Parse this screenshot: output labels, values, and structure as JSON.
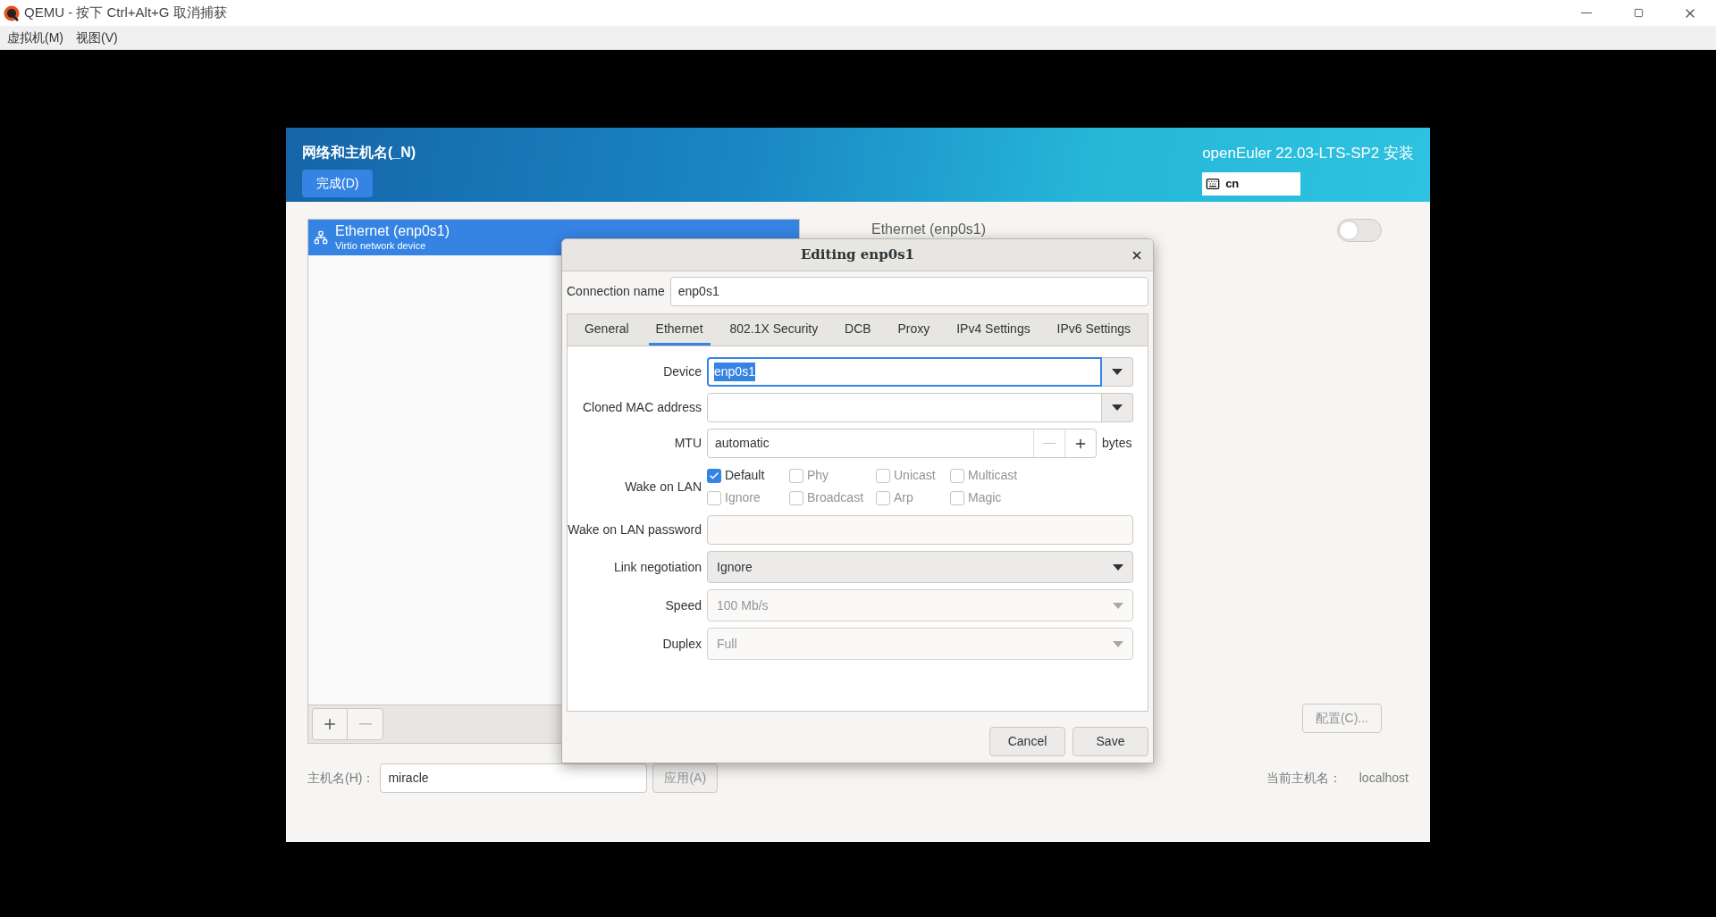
{
  "window": {
    "title": "QEMU - 按下 Ctrl+Alt+G 取消捕获"
  },
  "menu": [
    {
      "label": "虚拟机(M)"
    },
    {
      "label": "视图(V)"
    }
  ],
  "installer": {
    "title": "网络和主机名(_N)",
    "done_button": "完成(D)",
    "product": "openEuler 22.03-LTS-SP2 安装",
    "keyboard_layout": "cn"
  },
  "devices": [
    {
      "name": "Ethernet (enp0s1)",
      "description": "Virtio network device",
      "selected": true
    }
  ],
  "device_detail": {
    "title": "Ethernet (enp0s1)",
    "on": false,
    "configure_button": "配置(C)..."
  },
  "hostname": {
    "label": "主机名(H)：",
    "value": "miracle",
    "apply_button": "应用(A)",
    "current_label": "当前主机名：",
    "current_value": "localhost"
  },
  "dialog": {
    "title": "Editing enp0s1",
    "connection_name_label": "Connection name",
    "connection_name": "enp0s1",
    "tabs": [
      {
        "label": "General",
        "selected": false
      },
      {
        "label": "Ethernet",
        "selected": true
      },
      {
        "label": "802.1X Security",
        "selected": false
      },
      {
        "label": "DCB",
        "selected": false
      },
      {
        "label": "Proxy",
        "selected": false
      },
      {
        "label": "IPv4 Settings",
        "selected": false
      },
      {
        "label": "IPv6 Settings",
        "selected": false
      }
    ],
    "fields": [
      {
        "kind": "combo",
        "label": "Device",
        "value": "enp0s1",
        "focused": true
      },
      {
        "kind": "combo",
        "label": "Cloned MAC address",
        "focused": false
      },
      {
        "kind": "spin",
        "label": "MTU",
        "value": "automatic",
        "unit": "bytes"
      },
      {
        "kind": "checks",
        "label": "Wake on LAN",
        "options": [
          {
            "label": "Default",
            "checked": true,
            "disabled": false
          },
          {
            "label": "Phy",
            "checked": false,
            "disabled": true
          },
          {
            "label": "Unicast",
            "checked": false,
            "disabled": true
          },
          {
            "label": "Multicast",
            "checked": false,
            "disabled": true
          },
          {
            "label": "Ignore",
            "checked": false,
            "disabled": true
          },
          {
            "label": "Broadcast",
            "checked": false,
            "disabled": true
          },
          {
            "label": "Arp",
            "checked": false,
            "disabled": true
          },
          {
            "label": "Magic",
            "checked": false,
            "disabled": true
          }
        ]
      },
      {
        "kind": "entry",
        "label": "Wake on LAN password"
      },
      {
        "kind": "dropdown",
        "label": "Link negotiation",
        "value": "Ignore",
        "disabled": false
      },
      {
        "kind": "dropdown",
        "label": "Speed",
        "value": "100 Mb/s",
        "disabled": true
      },
      {
        "kind": "dropdown",
        "label": "Duplex",
        "value": "Full",
        "disabled": true
      }
    ],
    "buttons": [
      {
        "label": "Cancel"
      },
      {
        "label": "Save"
      }
    ]
  }
}
